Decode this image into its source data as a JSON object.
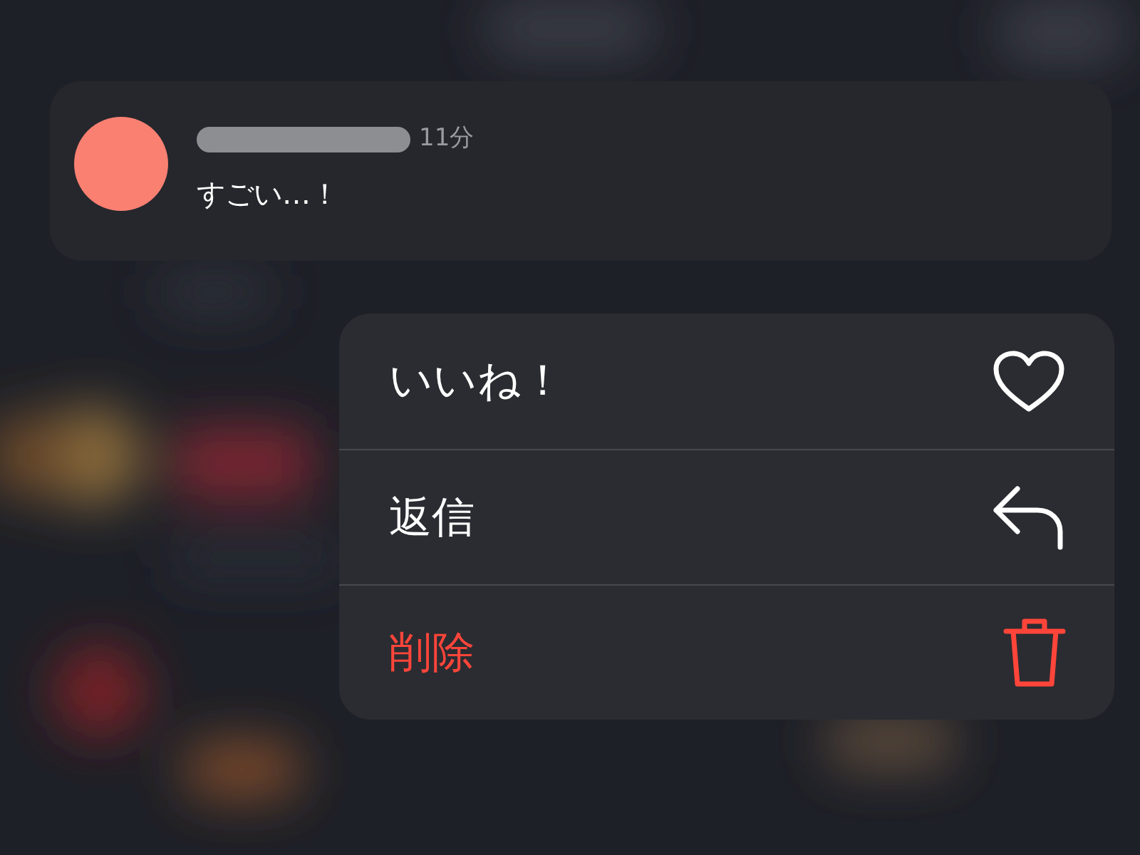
{
  "comment": {
    "time": "11分",
    "text": "すごい…！"
  },
  "menu": [
    {
      "label": "いいね！",
      "kind": "heart",
      "destructive": false
    },
    {
      "label": "返信",
      "kind": "reply",
      "destructive": false
    },
    {
      "label": "削除",
      "kind": "trash",
      "destructive": true
    }
  ]
}
